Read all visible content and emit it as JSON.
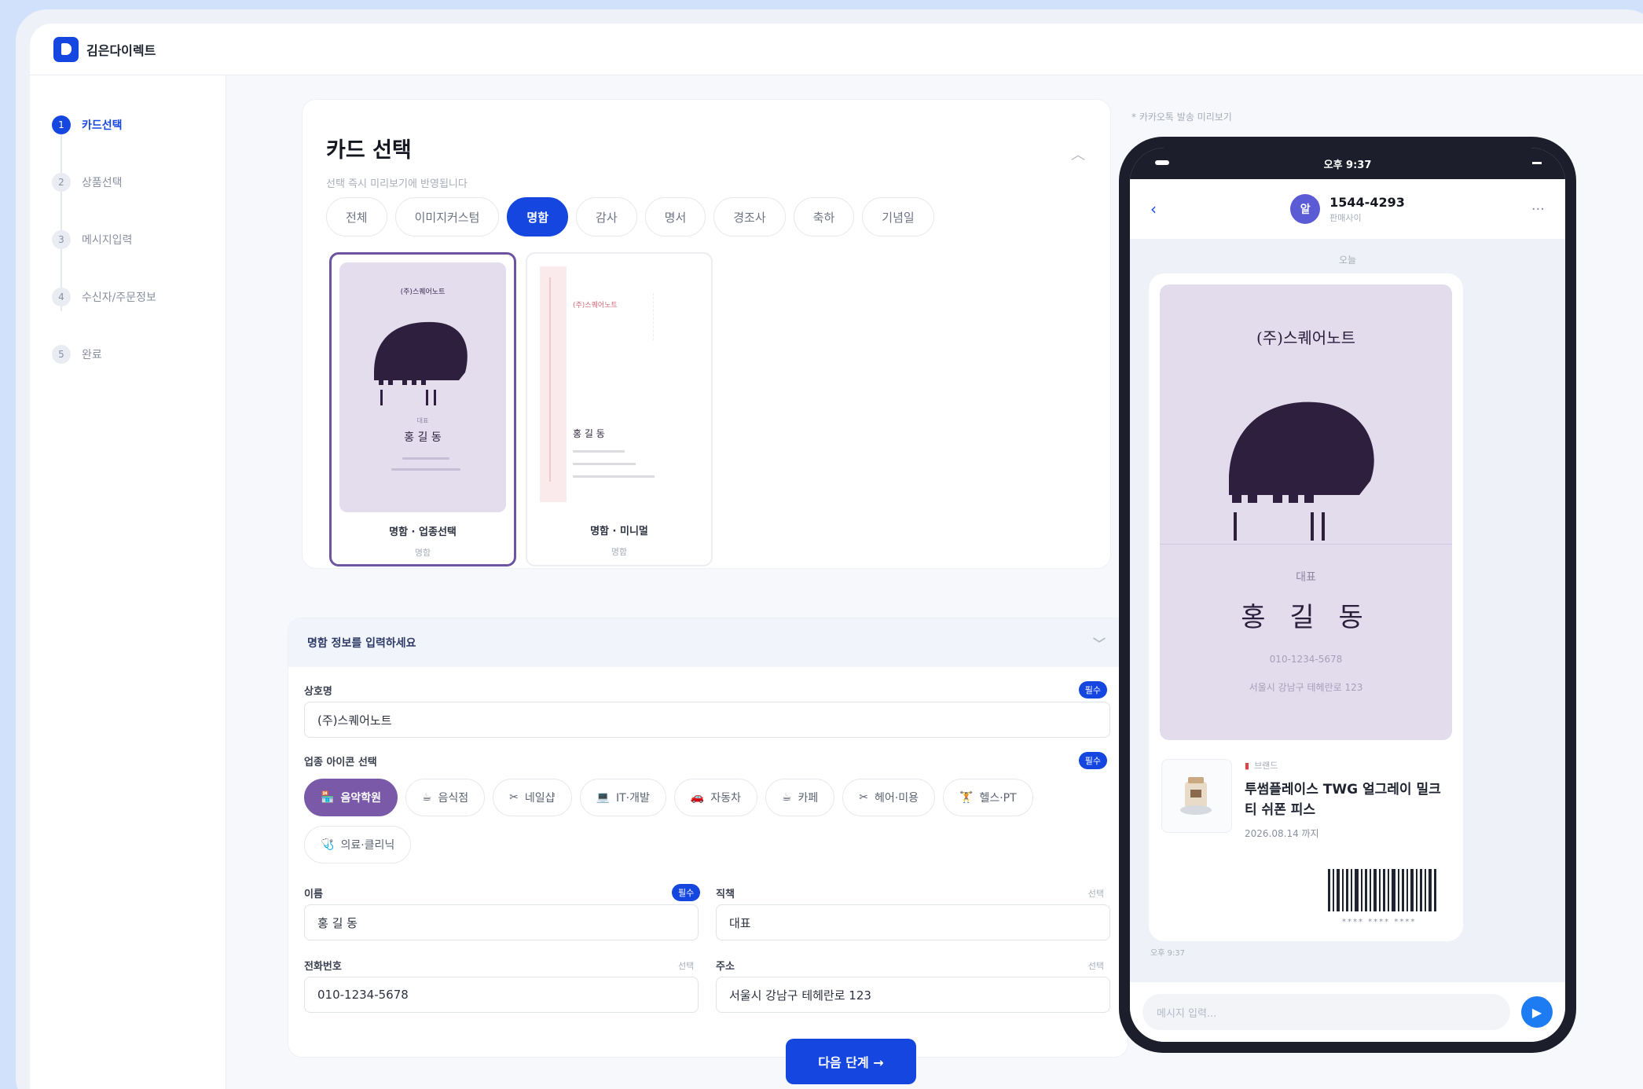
{
  "app": {
    "title": "김은다이렉트"
  },
  "steps": [
    {
      "num": "1",
      "label": "카드선택"
    },
    {
      "num": "2",
      "label": "상품선택"
    },
    {
      "num": "3",
      "label": "메시지입력"
    },
    {
      "num": "4",
      "label": "수신자/주문정보"
    },
    {
      "num": "5",
      "label": "완료"
    }
  ],
  "card_select": {
    "title": "카드 선택",
    "subtitle": "선택 즉시 미리보기에 반영됩니다",
    "categories": [
      "전체",
      "이미지커스텀",
      "명함",
      "감사",
      "명서",
      "경조사",
      "축하",
      "기념일"
    ],
    "active_category": "명함",
    "cards": [
      {
        "name": "명함 · 업종선택",
        "sub": "명함",
        "selected": true
      },
      {
        "name": "명함 · 미니멀",
        "sub": "명함",
        "selected": false
      }
    ],
    "thumb1": {
      "company": "(주)스퀘어노트",
      "role": "대표",
      "name": "홍 길 동"
    },
    "thumb2": {
      "company": "(주)스퀘어노트",
      "name": "홍 길 동"
    }
  },
  "form": {
    "header": "명함 정보를 입력하세요",
    "company_label": "상호명",
    "company_value": "(주)스퀘어노트",
    "icon_label": "업종 아이콘 선택",
    "required": "필수",
    "optional": "선택",
    "icons": [
      {
        "glyph": "🏪",
        "label": "음악학원",
        "active": true
      },
      {
        "glyph": "☕",
        "label": "음식점",
        "active": false
      },
      {
        "glyph": "✂",
        "label": "네일샵",
        "active": false
      },
      {
        "glyph": "💻",
        "label": "IT·개발",
        "active": false
      },
      {
        "glyph": "🚗",
        "label": "자동차",
        "active": false
      },
      {
        "glyph": "☕",
        "label": "카페",
        "active": false
      },
      {
        "glyph": "✂",
        "label": "헤어·미용",
        "active": false
      },
      {
        "glyph": "🏋",
        "label": "헬스·PT",
        "active": false
      },
      {
        "glyph": "🩺",
        "label": "의료·클리닉",
        "active": false
      }
    ],
    "name_label": "이름",
    "name_value": "홍 길 동",
    "title_label": "직책",
    "title_value": "대표",
    "phone_label": "전화번호",
    "phone_value": "010-1234-5678",
    "address_label": "주소",
    "address_value": "서울시 강남구 테헤란로 123"
  },
  "next_button": "다음 단계 →",
  "preview": {
    "label": "* 카카오톡 발송 미리보기",
    "time": "오후 9:37",
    "sender": "1544-4293",
    "sender_sub": "판매사이",
    "avatar": "알",
    "day": "오늘",
    "card": {
      "company": "(주)스퀘어노트",
      "role": "대표",
      "name": "홍 길 동",
      "phone": "010-1234-5678",
      "address": "서울시 강남구 테헤란로 123"
    },
    "gift": {
      "brand": "브랜드",
      "product": "투썸플레이스 TWG 얼그레이 밀크티 쉬폰 피스",
      "expiry": "2026.08.14 까지",
      "code": "**** **** ****"
    },
    "timestamp": "오후 9:37",
    "input_placeholder": "메시지 입력..."
  }
}
